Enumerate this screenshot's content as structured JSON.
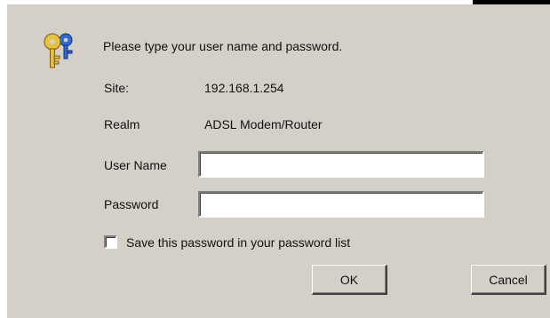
{
  "dialog": {
    "prompt": "Please type your user name and password.",
    "site_label": "Site:",
    "site_value": "192.168.1.254",
    "realm_label": "Realm",
    "realm_value": "ADSL Modem/Router",
    "username_label": "User Name",
    "username_value": "",
    "password_label": "Password",
    "password_value": "",
    "save_password_label": "Save this password in your password list",
    "save_password_checked": false,
    "ok_label": "OK",
    "cancel_label": "Cancel",
    "icon": "keys-icon"
  },
  "colors": {
    "dialog_background": "#d4d0c8",
    "key_gold": "#e8c23a",
    "key_blue": "#2b6bd6"
  }
}
